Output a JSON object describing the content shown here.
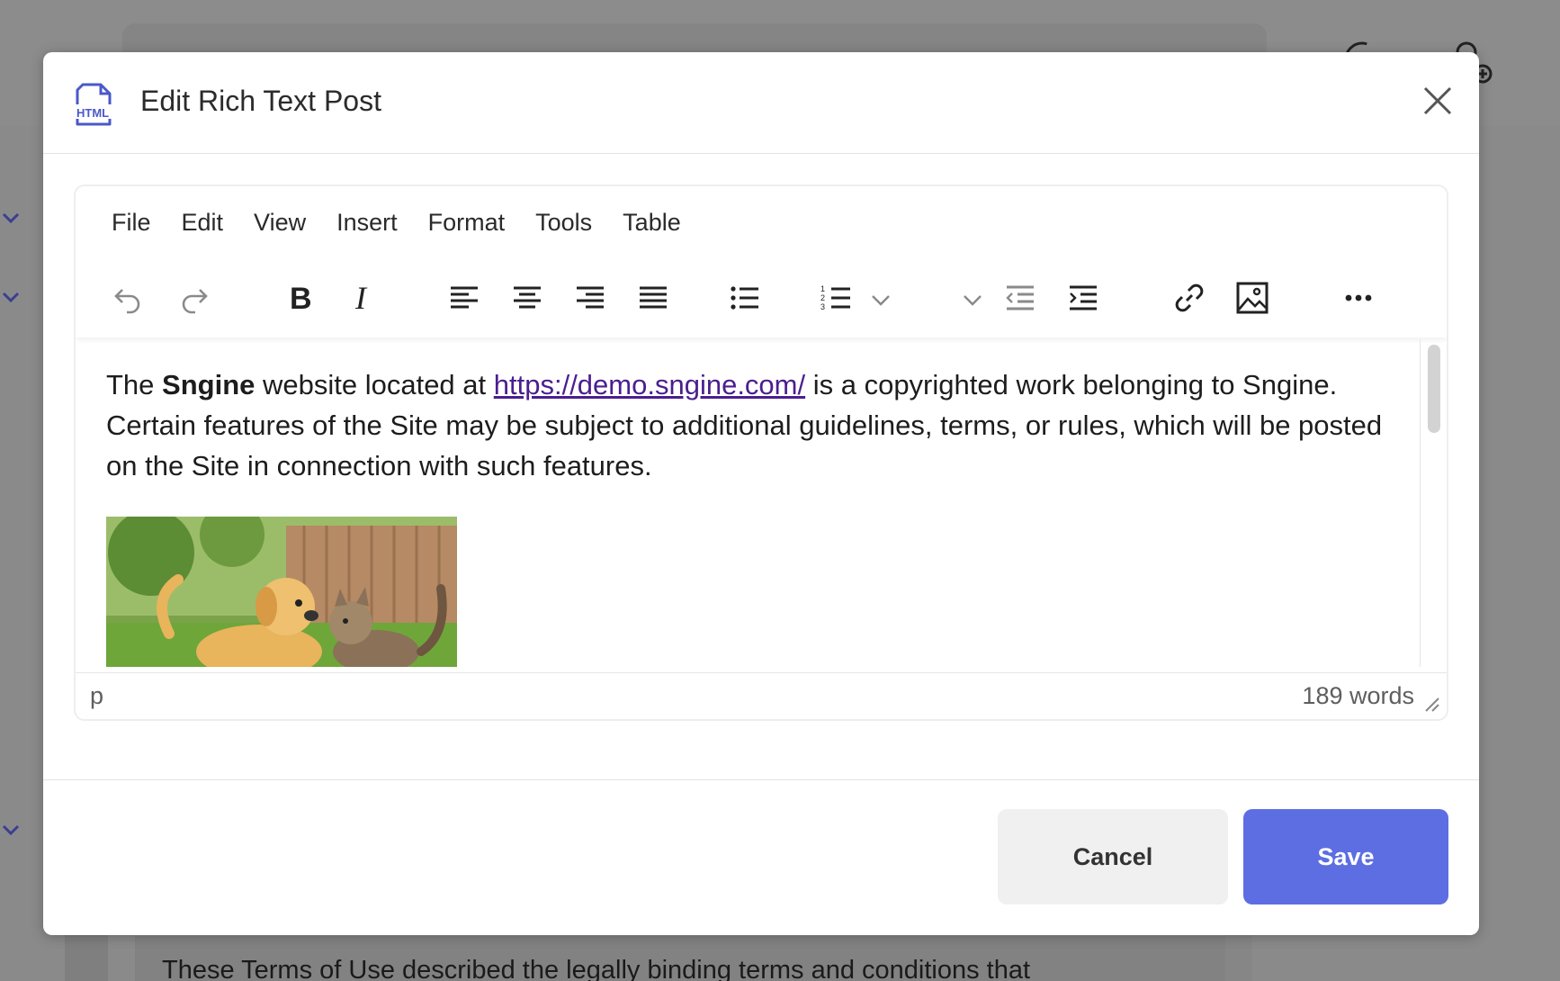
{
  "background": {
    "card_text": "These Terms of Use described the legally binding terms and conditions that"
  },
  "modal": {
    "title": "Edit Rich Text Post",
    "icon": "html-file-icon",
    "close_icon": "close-icon"
  },
  "editor": {
    "menu": [
      "File",
      "Edit",
      "View",
      "Insert",
      "Format",
      "Tools",
      "Table"
    ],
    "toolbar": [
      "undo-icon",
      "redo-icon",
      "bold-icon",
      "italic-icon",
      "align-left-icon",
      "align-center-icon",
      "align-right-icon",
      "align-justify-icon",
      "bullet-list-icon",
      "numbered-list-icon",
      "outdent-icon",
      "indent-icon",
      "link-icon",
      "image-icon",
      "more-icon"
    ],
    "content": {
      "before_bold": "The ",
      "bold": "Sngine",
      "after_bold": " website located at ",
      "link": "https://demo.sngine.com/",
      "after_link": " is a copyrighted work belonging to Sngine. Certain features of the Site may be subject to additional guidelines, terms, or rules, which will be posted on the Site in connection with such features.",
      "image": "puppy and kitten playing in garden"
    },
    "status": {
      "path": "p",
      "word_count": "189 words"
    }
  },
  "footer": {
    "cancel_label": "Cancel",
    "save_label": "Save"
  },
  "colors": {
    "accent": "#5d6ee3",
    "link": "#4b1e8f",
    "icon_blue": "#4a58c9"
  }
}
